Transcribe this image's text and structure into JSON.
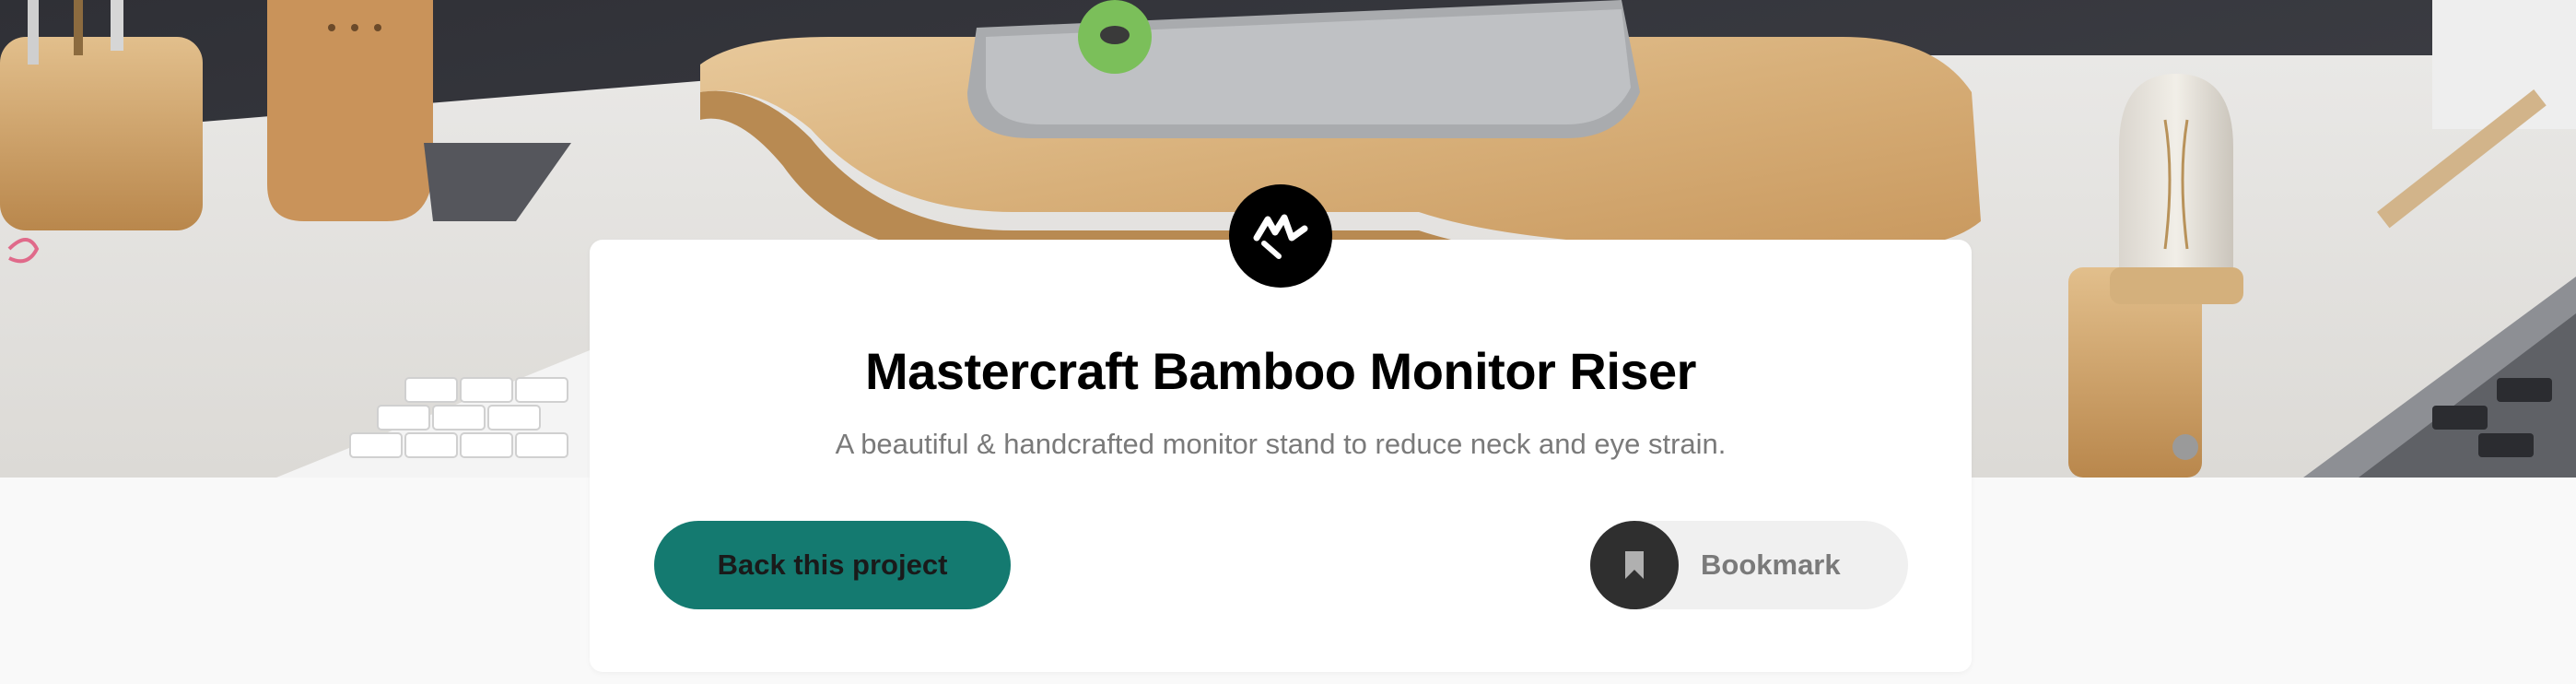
{
  "hero": {
    "image_alt": "Wooden desk setup with bamboo monitor riser, keyboard and lamp"
  },
  "brand": {
    "logo_icon": "m-logo-icon"
  },
  "project": {
    "title": "Mastercraft Bamboo Monitor Riser",
    "description": "A beautiful & handcrafted monitor stand to reduce neck and eye strain."
  },
  "actions": {
    "back_label": "Back this project",
    "bookmark_label": "Bookmark",
    "bookmark_icon": "bookmark-icon"
  },
  "colors": {
    "accent": "#147a70",
    "background": "#f9f9f9",
    "card": "#ffffff",
    "dark": "#2f2f2f",
    "muted_text": "#7a7a7a"
  }
}
